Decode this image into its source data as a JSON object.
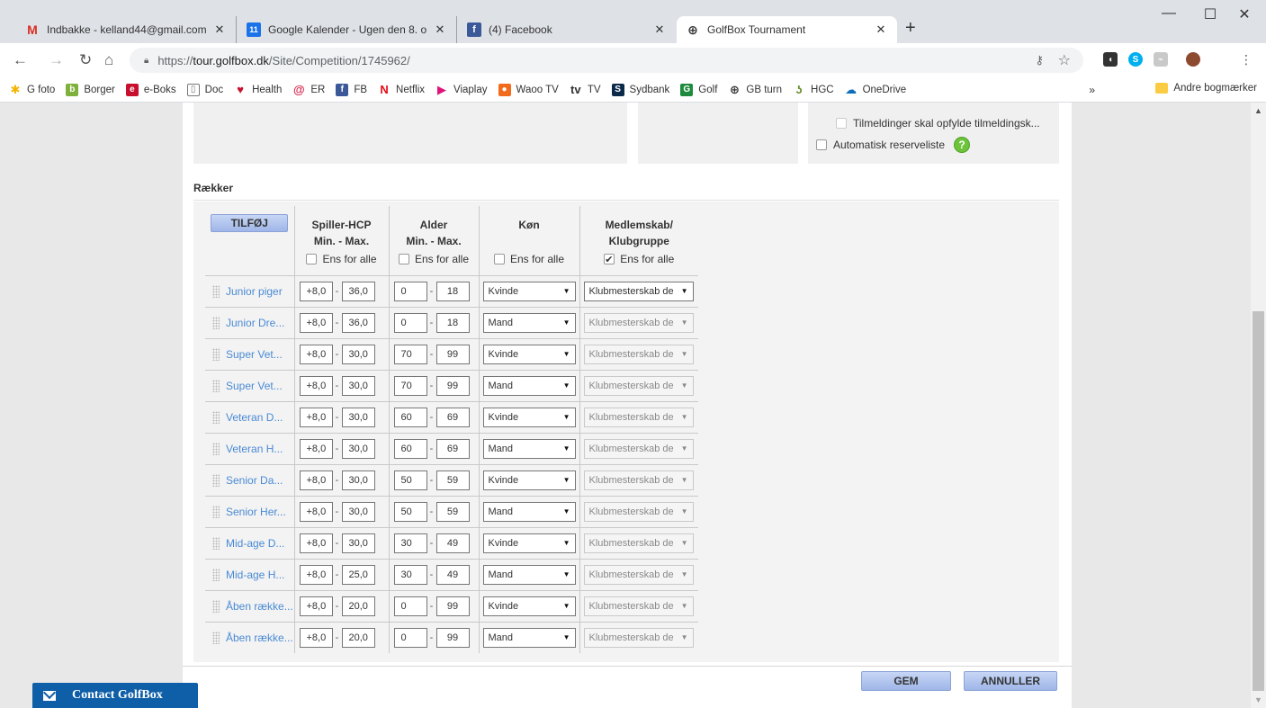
{
  "tabs": [
    {
      "title": "Indbakke - kelland44@gmail.com",
      "icon": "gmail-icon",
      "active": false
    },
    {
      "title": "Google Kalender - Ugen den 8. o",
      "icon": "google-calendar-icon",
      "active": false
    },
    {
      "title": "(4) Facebook",
      "icon": "facebook-icon",
      "active": false
    },
    {
      "title": "GolfBox Tournament",
      "icon": "globe-icon",
      "active": true
    }
  ],
  "address_bar": {
    "scheme": "https://",
    "domain": "tour.golfbox.dk",
    "path": "/Site/Competition/1745962/"
  },
  "bookmarks": [
    {
      "label": "G foto",
      "icon": "google-photos-icon",
      "color": "#f4b400"
    },
    {
      "label": "Borger",
      "icon": "borger-icon",
      "color": "#7fb03c"
    },
    {
      "label": "e-Boks",
      "icon": "eboks-icon",
      "color": "#c8102e"
    },
    {
      "label": "Doc",
      "icon": "document-icon",
      "color": "#ffffff"
    },
    {
      "label": "Health",
      "icon": "heart-icon",
      "color": "#c8102e"
    },
    {
      "label": "ER",
      "icon": "er-icon",
      "color": "#d9254b"
    },
    {
      "label": "FB",
      "icon": "facebook-icon",
      "color": "#3b5998"
    },
    {
      "label": "Netflix",
      "icon": "netflix-icon",
      "color": "#e50914"
    },
    {
      "label": "Viaplay",
      "icon": "viaplay-icon",
      "color": "#e0127b"
    },
    {
      "label": "Waoo TV",
      "icon": "waoo-icon",
      "color": "#f26b1d"
    },
    {
      "label": "TV",
      "icon": "tv-icon",
      "color": "#333333"
    },
    {
      "label": "Sydbank",
      "icon": "sydbank-icon",
      "color": "#0b2a4a"
    },
    {
      "label": "Golf",
      "icon": "golf-icon",
      "color": "#1d8a3c"
    },
    {
      "label": "GB turn",
      "icon": "globe-icon",
      "color": "#333333"
    },
    {
      "label": "HGC",
      "icon": "hgc-icon",
      "color": "#6a8f2f"
    },
    {
      "label": "OneDrive",
      "icon": "onedrive-icon",
      "color": "#0f6cbd"
    }
  ],
  "bookmarks_more": "»",
  "bookmarks_other": "Andre bogmærker",
  "options": {
    "tilmeldinger": "Tilmeldinger skal opfylde tilmeldingsk...",
    "reserveliste": "Automatisk reserveliste"
  },
  "section_title": "Rækker",
  "columns": {
    "add_label": "TILFØJ",
    "hcp_line1": "Spiller-HCP",
    "hcp_line2": "Min. - Max.",
    "age_line1": "Alder",
    "age_line2": "Min. - Max.",
    "gender": "Køn",
    "member_line1": "Medlemskab/",
    "member_line2": "Klubgruppe",
    "same_for_all": "Ens for alle"
  },
  "rows": [
    {
      "name": "Junior piger",
      "hcp_min": "+8,0",
      "hcp_max": "36,0",
      "age_min": "0",
      "age_max": "18",
      "gender": "Kvinde",
      "member": "Klubmesterskab de",
      "member_enabled": true
    },
    {
      "name": "Junior Dre...",
      "hcp_min": "+8,0",
      "hcp_max": "36,0",
      "age_min": "0",
      "age_max": "18",
      "gender": "Mand",
      "member": "Klubmesterskab de",
      "member_enabled": false
    },
    {
      "name": "Super Vet...",
      "hcp_min": "+8,0",
      "hcp_max": "30,0",
      "age_min": "70",
      "age_max": "99",
      "gender": "Kvinde",
      "member": "Klubmesterskab de",
      "member_enabled": false
    },
    {
      "name": "Super Vet...",
      "hcp_min": "+8,0",
      "hcp_max": "30,0",
      "age_min": "70",
      "age_max": "99",
      "gender": "Mand",
      "member": "Klubmesterskab de",
      "member_enabled": false
    },
    {
      "name": "Veteran D...",
      "hcp_min": "+8,0",
      "hcp_max": "30,0",
      "age_min": "60",
      "age_max": "69",
      "gender": "Kvinde",
      "member": "Klubmesterskab de",
      "member_enabled": false
    },
    {
      "name": "Veteran H...",
      "hcp_min": "+8,0",
      "hcp_max": "30,0",
      "age_min": "60",
      "age_max": "69",
      "gender": "Mand",
      "member": "Klubmesterskab de",
      "member_enabled": false
    },
    {
      "name": "Senior Da...",
      "hcp_min": "+8,0",
      "hcp_max": "30,0",
      "age_min": "50",
      "age_max": "59",
      "gender": "Kvinde",
      "member": "Klubmesterskab de",
      "member_enabled": false
    },
    {
      "name": "Senior Her...",
      "hcp_min": "+8,0",
      "hcp_max": "30,0",
      "age_min": "50",
      "age_max": "59",
      "gender": "Mand",
      "member": "Klubmesterskab de",
      "member_enabled": false
    },
    {
      "name": "Mid-age D...",
      "hcp_min": "+8,0",
      "hcp_max": "30,0",
      "age_min": "30",
      "age_max": "49",
      "gender": "Kvinde",
      "member": "Klubmesterskab de",
      "member_enabled": false
    },
    {
      "name": "Mid-age H...",
      "hcp_min": "+8,0",
      "hcp_max": "25,0",
      "age_min": "30",
      "age_max": "49",
      "gender": "Mand",
      "member": "Klubmesterskab de",
      "member_enabled": false
    },
    {
      "name": "Åben række...",
      "hcp_min": "+8,0",
      "hcp_max": "20,0",
      "age_min": "0",
      "age_max": "99",
      "gender": "Kvinde",
      "member": "Klubmesterskab de",
      "member_enabled": false
    },
    {
      "name": "Åben række...",
      "hcp_min": "+8,0",
      "hcp_max": "20,0",
      "age_min": "0",
      "age_max": "99",
      "gender": "Mand",
      "member": "Klubmesterskab de",
      "member_enabled": false
    }
  ],
  "buttons": {
    "save": "GEM",
    "cancel": "ANNULLER"
  },
  "contact": "Contact GolfBox"
}
